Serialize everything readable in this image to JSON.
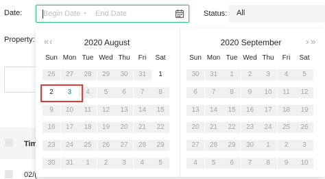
{
  "form": {
    "date_label": "Date:",
    "begin_placeholder": "Begin Date",
    "range_separator": "-",
    "end_placeholder": "End Date",
    "status_label": "Status:",
    "status_value": "All",
    "property_label": "Property:",
    "table_header_partial": "Tim",
    "table_row_partial": "02/("
  },
  "calendar": {
    "weekdays": [
      "Sun",
      "Mon",
      "Tue",
      "Wed",
      "Thu",
      "Fri",
      "Sat"
    ],
    "prev_year_glyph": "«",
    "prev_month_glyph": "‹",
    "next_month_glyph": "›",
    "next_year_glyph": "»",
    "left": {
      "title": "2020 August",
      "rows": [
        [
          "26",
          "27",
          "28",
          "29",
          "30",
          "31",
          "1"
        ],
        [
          "2",
          "3",
          "4",
          "5",
          "6",
          "7",
          "8"
        ],
        [
          "9",
          "10",
          "11",
          "12",
          "13",
          "14",
          "15"
        ],
        [
          "16",
          "17",
          "18",
          "19",
          "20",
          "21",
          "22"
        ],
        [
          "23",
          "24",
          "25",
          "26",
          "27",
          "28",
          "29"
        ],
        [
          "30",
          "31",
          "1",
          "2",
          "3",
          "4",
          "5"
        ]
      ],
      "in_month": [
        [
          false,
          false,
          false,
          false,
          false,
          false,
          true
        ],
        [
          true,
          true,
          true,
          true,
          true,
          true,
          true
        ],
        [
          true,
          true,
          true,
          true,
          true,
          true,
          true
        ],
        [
          true,
          true,
          true,
          true,
          true,
          true,
          true
        ],
        [
          true,
          true,
          true,
          true,
          true,
          true,
          true
        ],
        [
          true,
          true,
          false,
          false,
          false,
          false,
          false
        ]
      ],
      "enabled_cells": [
        [
          0,
          6
        ],
        [
          1,
          0
        ],
        [
          1,
          1
        ]
      ],
      "today": [
        1,
        1
      ]
    },
    "right": {
      "title": "2020 September",
      "rows": [
        [
          "30",
          "31",
          "1",
          "2",
          "3",
          "4",
          "5"
        ],
        [
          "6",
          "7",
          "8",
          "9",
          "10",
          "11",
          "12"
        ],
        [
          "13",
          "14",
          "15",
          "16",
          "17",
          "18",
          "19"
        ],
        [
          "20",
          "21",
          "22",
          "23",
          "24",
          "25",
          "26"
        ],
        [
          "27",
          "28",
          "29",
          "30",
          "1",
          "2",
          "3"
        ],
        [
          "4",
          "5",
          "6",
          "7",
          "8",
          "9",
          "10"
        ]
      ]
    }
  },
  "annotation": {
    "highlight_color": "#e53935"
  },
  "theme": {
    "accent": "#3bb98e",
    "disabled_bg": "#f0f0f0"
  }
}
